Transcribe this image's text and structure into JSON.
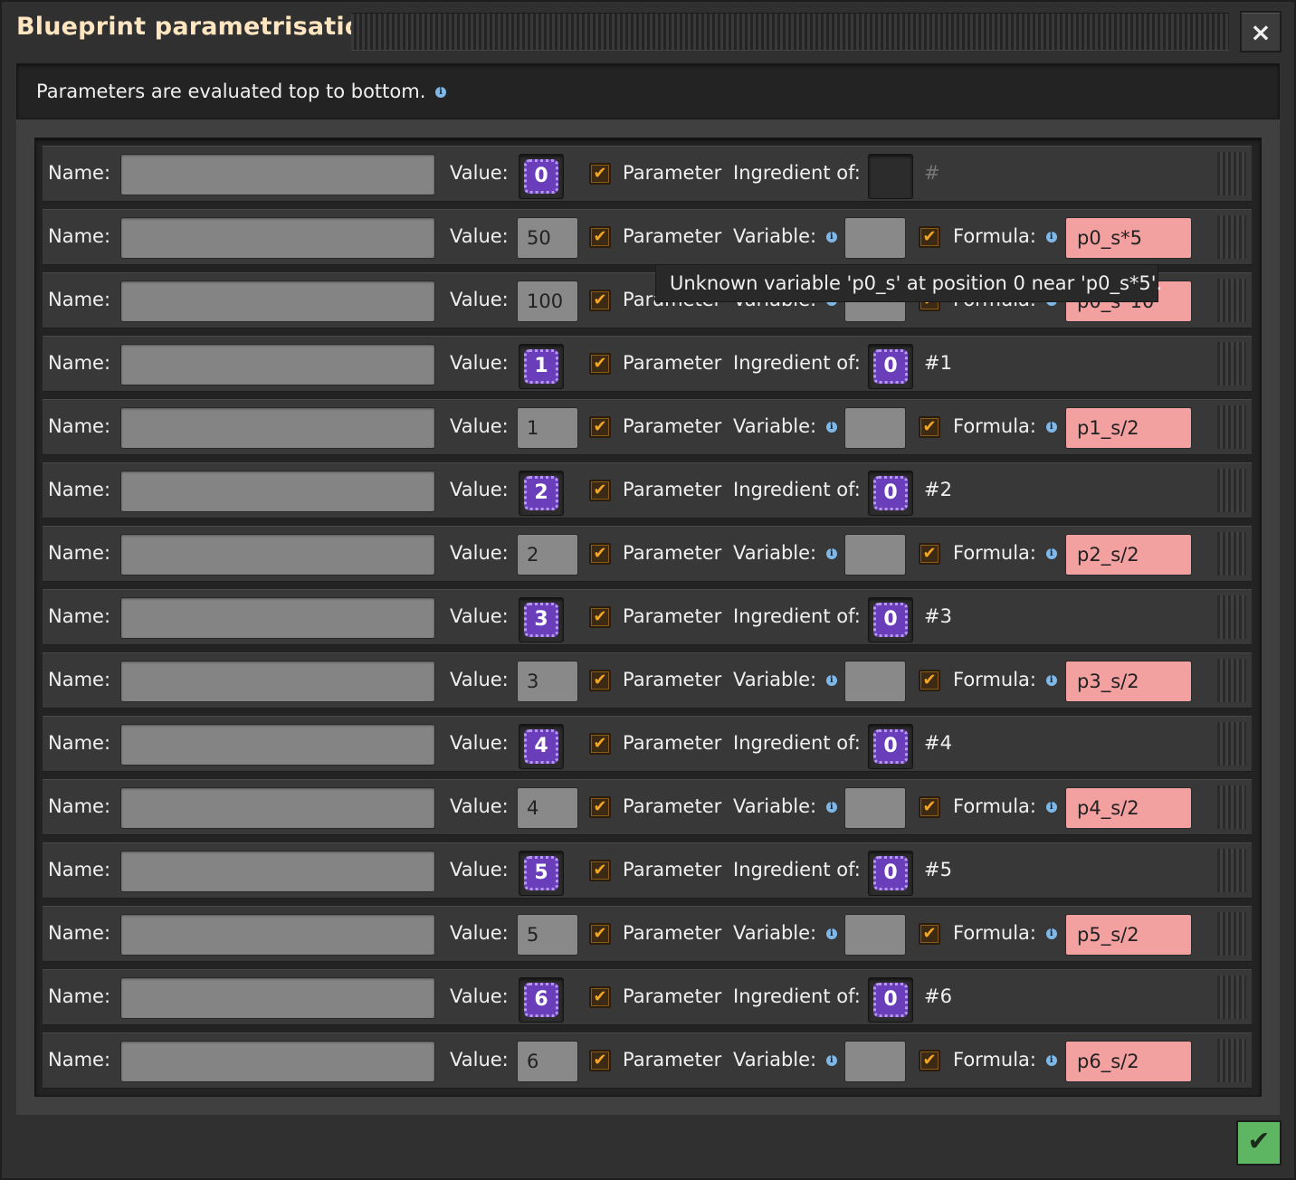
{
  "window": {
    "title": "Blueprint parametrisation",
    "close_icon": "×",
    "info_text": "Parameters are evaluated top to bottom.",
    "info_icon": "i",
    "confirm_icon": "✔"
  },
  "labels": {
    "name": "Name:",
    "value": "Value:",
    "parameter": "Parameter",
    "ingredient_of": "Ingredient of:",
    "variable": "Variable:",
    "formula": "Formula:",
    "check": "✔"
  },
  "tooltip": "Unknown variable 'p0_s' at position 0 near 'p0_s*5'.",
  "rows": [
    {
      "type": "item",
      "value": "0",
      "ingredient_of": "",
      "hash": "#"
    },
    {
      "type": "number",
      "value": "50",
      "formula": "p0_s*5"
    },
    {
      "type": "number",
      "value": "100",
      "formula": "p0_s*10"
    },
    {
      "type": "item",
      "value": "1",
      "ingredient_of": "0",
      "hash": "#1"
    },
    {
      "type": "number",
      "value": "1",
      "formula": "p1_s/2"
    },
    {
      "type": "item",
      "value": "2",
      "ingredient_of": "0",
      "hash": "#2"
    },
    {
      "type": "number",
      "value": "2",
      "formula": "p2_s/2"
    },
    {
      "type": "item",
      "value": "3",
      "ingredient_of": "0",
      "hash": "#3"
    },
    {
      "type": "number",
      "value": "3",
      "formula": "p3_s/2"
    },
    {
      "type": "item",
      "value": "4",
      "ingredient_of": "0",
      "hash": "#4"
    },
    {
      "type": "number",
      "value": "4",
      "formula": "p4_s/2"
    },
    {
      "type": "item",
      "value": "5",
      "ingredient_of": "0",
      "hash": "#5"
    },
    {
      "type": "number",
      "value": "5",
      "formula": "p5_s/2"
    },
    {
      "type": "item",
      "value": "6",
      "ingredient_of": "0",
      "hash": "#6"
    },
    {
      "type": "number",
      "value": "6",
      "formula": "p6_s/2"
    }
  ],
  "colors": {
    "title": "#ffe6c0",
    "formula_error_bg": "#f2a0a0",
    "checkbox_check": "#f5a623",
    "parameter_chip": "#6a3dbb",
    "confirm_button": "#5eb663"
  }
}
